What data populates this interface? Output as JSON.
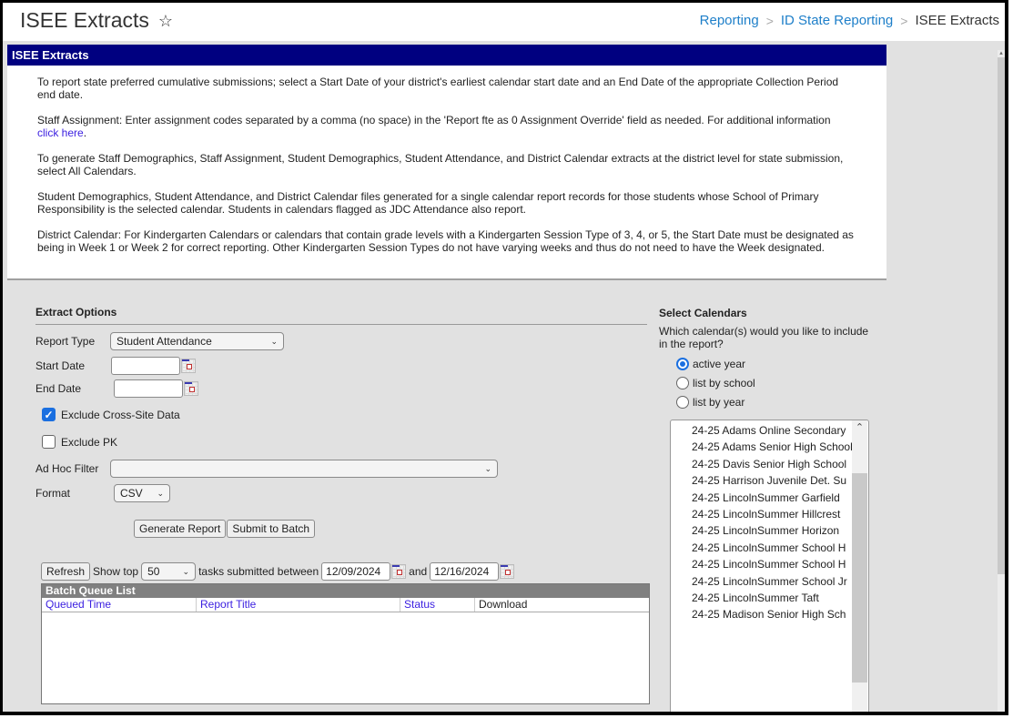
{
  "header": {
    "title": "ISEE Extracts",
    "favorite_icon": "star-outline-icon",
    "breadcrumb": [
      {
        "label": "Reporting",
        "link": true
      },
      {
        "label": "ID State Reporting",
        "link": true
      },
      {
        "label": "ISEE Extracts",
        "link": false
      }
    ],
    "breadcrumb_separator": ">"
  },
  "info": {
    "heading": "ISEE Extracts",
    "paragraphs": [
      "To report state preferred cumulative submissions; select a Start Date of your district's earliest calendar start date and an End Date of the appropriate Collection Period end date.",
      "Staff Assignment: Enter assignment codes separated by a comma (no space) in the 'Report fte as 0 Assignment Override' field as needed. For additional information",
      "To generate Staff Demographics, Staff Assignment, Student Demographics, Student Attendance, and District Calendar extracts at the district level for state submission, select All Calendars.",
      "Student Demographics, Student Attendance, and District Calendar files generated for a single calendar report records for those students whose School of Primary Responsibility is the selected calendar. Students in calendars flagged as JDC Attendance also report.",
      "District Calendar: For Kindergarten Calendars or calendars that contain grade levels with a Kindergarten Session Type of 3, 4, or 5, the Start Date must be designated as being in Week 1 or Week 2 for correct reporting. Other Kindergarten Session Types do not have varying weeks and thus do not need to have the Week designated."
    ],
    "link_text": "click here",
    "link_suffix": "."
  },
  "extract_options": {
    "title": "Extract Options",
    "report_type_label": "Report Type",
    "report_type_value": "Student Attendance",
    "start_date_label": "Start Date",
    "start_date_value": "",
    "end_date_label": "End Date",
    "end_date_value": "",
    "exclude_cross_site_label": "Exclude Cross-Site Data",
    "exclude_cross_site_checked": true,
    "exclude_pk_label": "Exclude PK",
    "exclude_pk_checked": false,
    "ad_hoc_filter_label": "Ad Hoc Filter",
    "ad_hoc_filter_value": "",
    "format_label": "Format",
    "format_value": "CSV",
    "generate_button": "Generate Report",
    "batch_button": "Submit to Batch"
  },
  "batch": {
    "refresh_button": "Refresh",
    "show_top_label": "Show top",
    "show_top_value": "50",
    "between_label": "tasks submitted between",
    "from_date": "12/09/2024",
    "and_label": "and",
    "to_date": "12/16/2024",
    "list_title": "Batch Queue List",
    "columns": [
      "Queued Time",
      "Report Title",
      "Status",
      "Download"
    ],
    "rows": []
  },
  "calendars": {
    "title": "Select Calendars",
    "question": "Which calendar(s) would you like to include in the report?",
    "options": [
      {
        "label": "active year",
        "selected": true
      },
      {
        "label": "list by school",
        "selected": false
      },
      {
        "label": "list by year",
        "selected": false
      }
    ],
    "list": [
      "24-25 Adams Online Secondary",
      "24-25 Adams Senior High School",
      "24-25 Davis Senior High School",
      "24-25 Harrison Juvenile Det. Su",
      "24-25 LincolnSummer Garfield",
      "24-25 LincolnSummer Hillcrest",
      "24-25 LincolnSummer Horizon",
      "24-25 LincolnSummer School H",
      "24-25 LincolnSummer School H",
      "24-25 LincolnSummer School Jr",
      "24-25 LincolnSummer Taft",
      "24-25 Madison Senior High Sch"
    ]
  },
  "colors": {
    "header_bar": "#000080",
    "link": "#1e7fc9",
    "info_link": "#3a1ee0",
    "accent_checkbox": "#1a6fe0",
    "batch_header": "#808080",
    "page_bg": "#e1e1e1"
  }
}
